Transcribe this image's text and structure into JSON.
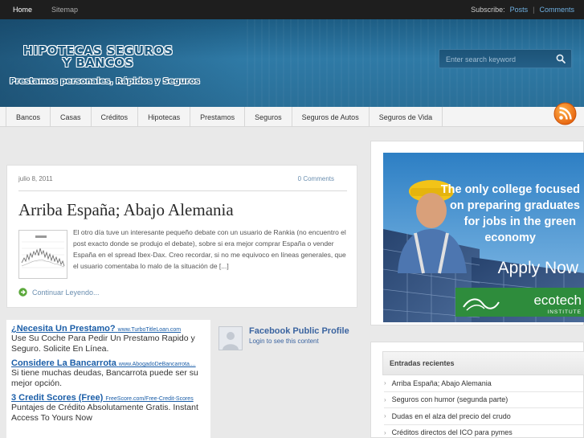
{
  "topbar": {
    "nav": [
      {
        "label": "Home"
      },
      {
        "label": "Sitemap"
      }
    ],
    "subscribe_label": "Subscribe:",
    "posts_label": "Posts",
    "separator": "|",
    "comments_label": "Comments"
  },
  "header": {
    "title_line1": "HIPOTECAS SEGUROS",
    "title_line2": "Y BANCOS",
    "tagline": "Prestamos personales, Rápidos y Seguros",
    "search_placeholder": "Enter search keyword"
  },
  "nav": {
    "items": [
      {
        "label": "Bancos"
      },
      {
        "label": "Casas"
      },
      {
        "label": "Créditos"
      },
      {
        "label": "Hipotecas"
      },
      {
        "label": "Prestamos"
      },
      {
        "label": "Seguros"
      },
      {
        "label": "Seguros de Autos"
      },
      {
        "label": "Seguros de Vida"
      }
    ]
  },
  "post": {
    "date": "julio 8, 2011",
    "comments": "0 Comments",
    "title": "Arriba España; Abajo Alemania",
    "excerpt": "El otro día tuve un interesante pequeño debate con un usuario de Rankia (no encuentro el post exacto donde se produjo el debate), sobre si era mejor comprar España o vender España en el spread Ibex-Dax.  Creo recordar, si no me equivoco en líneas generales,  que el usuario comentaba lo malo de la situación de [...]",
    "more": "Continuar Leyendo..."
  },
  "ads": [
    {
      "title": "¿Necesita Un Prestamo?",
      "url": "www.TurboTitleLoan.com",
      "desc": "Use Su Coche Para Pedir Un Prestamo Rapido y Seguro. Solicite En Línea."
    },
    {
      "title": "Considere La Bancarrota",
      "url": "www.AbogadoDeBancarrota....",
      "desc": "Si tiene muchas deudas, Bancarrota puede ser su mejor opción."
    },
    {
      "title": "3 Credit Scores (Free)",
      "url": "FreeScore.com/Free-Credit-Scores",
      "desc": "Puntajes de Crédito Absolutamente Gratis. Instant Access To Yours Now"
    }
  ],
  "facebook": {
    "name": "Facebook Public Profile",
    "login": "Login to see this content"
  },
  "sidebar_ad": {
    "line1": "The only college focused",
    "line2": "on preparing graduates",
    "line3": "for jobs in the green",
    "line4": "economy",
    "cta": "Apply Now",
    "brand": "ecotech",
    "brand_sub": "INSTITUTE"
  },
  "recent": {
    "title": "Entradas recientes",
    "items": [
      {
        "label": "Arriba España; Abajo Alemania"
      },
      {
        "label": "Seguros con humor (segunda parte)"
      },
      {
        "label": "Dudas en el alza del precio del crudo"
      },
      {
        "label": "Créditos directos del ICO para pymes"
      }
    ]
  },
  "colors": {
    "header": "#2f7aa6",
    "link": "#1b5ea8",
    "topbar": "#1e1e1e"
  }
}
